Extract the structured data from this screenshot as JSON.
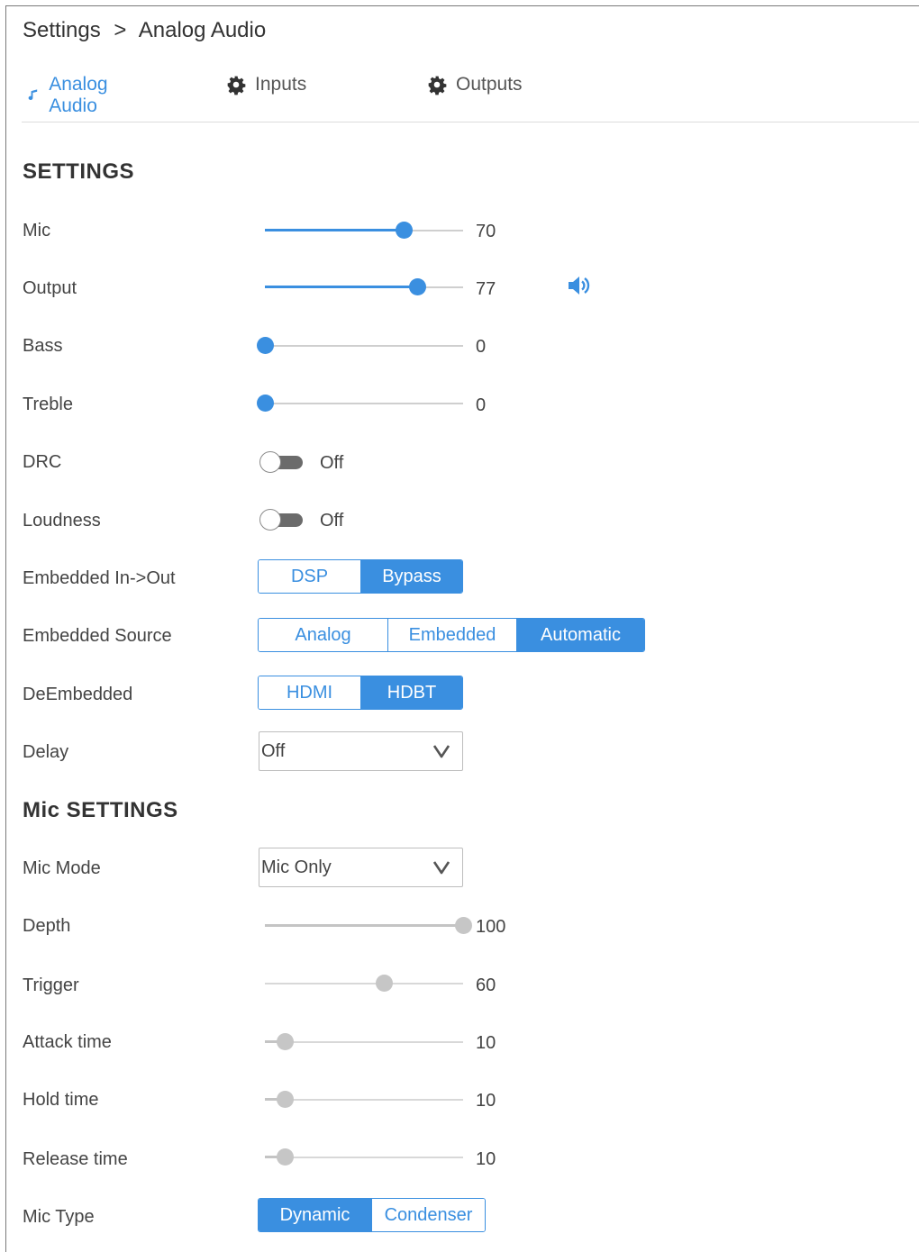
{
  "breadcrumb": {
    "root": "Settings",
    "separator": ">",
    "current": "Analog Audio"
  },
  "tabs": [
    {
      "label": "Analog Audio",
      "icon": "music-note-icon",
      "active": true
    },
    {
      "label": "Inputs",
      "icon": "gear-icon",
      "active": false
    },
    {
      "label": "Outputs",
      "icon": "gear-icon",
      "active": false
    }
  ],
  "colors": {
    "accent": "#3a8fe0",
    "disabled": "#c6c6c6"
  },
  "settings": {
    "title": "SETTINGS",
    "mic": {
      "label": "Mic",
      "value": "70",
      "level": 0.7
    },
    "output": {
      "label": "Output",
      "value": "77",
      "level": 0.77,
      "icon": "speaker-icon"
    },
    "bass": {
      "label": "Bass",
      "value": "0",
      "level": 0.0
    },
    "treble": {
      "label": "Treble",
      "value": "0",
      "level": 0.0
    },
    "drc": {
      "label": "DRC",
      "state": "Off"
    },
    "loudness": {
      "label": "Loudness",
      "state": "Off"
    },
    "embedded_in_out": {
      "label": "Embedded In->Out",
      "options": [
        "DSP",
        "Bypass"
      ],
      "selected": "Bypass"
    },
    "embedded_source": {
      "label": "Embedded Source",
      "options": [
        "Analog",
        "Embedded",
        "Automatic"
      ],
      "selected": "Automatic"
    },
    "deembedded": {
      "label": "DeEmbedded",
      "options": [
        "HDMI",
        "HDBT"
      ],
      "selected": "HDBT"
    },
    "delay": {
      "label": "Delay",
      "value": "Off"
    }
  },
  "mic_settings": {
    "title": "Mic SETTINGS",
    "mic_mode": {
      "label": "Mic Mode",
      "value": "Mic Only"
    },
    "depth": {
      "label": "Depth",
      "value": "100",
      "level": 1.0
    },
    "trigger": {
      "label": "Trigger",
      "value": "60",
      "level": 0.6
    },
    "attack_time": {
      "label": "Attack time",
      "value": "10",
      "level": 0.1
    },
    "hold_time": {
      "label": "Hold time",
      "value": "10",
      "level": 0.1
    },
    "release_time": {
      "label": "Release time",
      "value": "10",
      "level": 0.1
    },
    "mic_type": {
      "label": "Mic Type",
      "options": [
        "Dynamic",
        "Condenser"
      ],
      "selected": "Dynamic"
    }
  }
}
